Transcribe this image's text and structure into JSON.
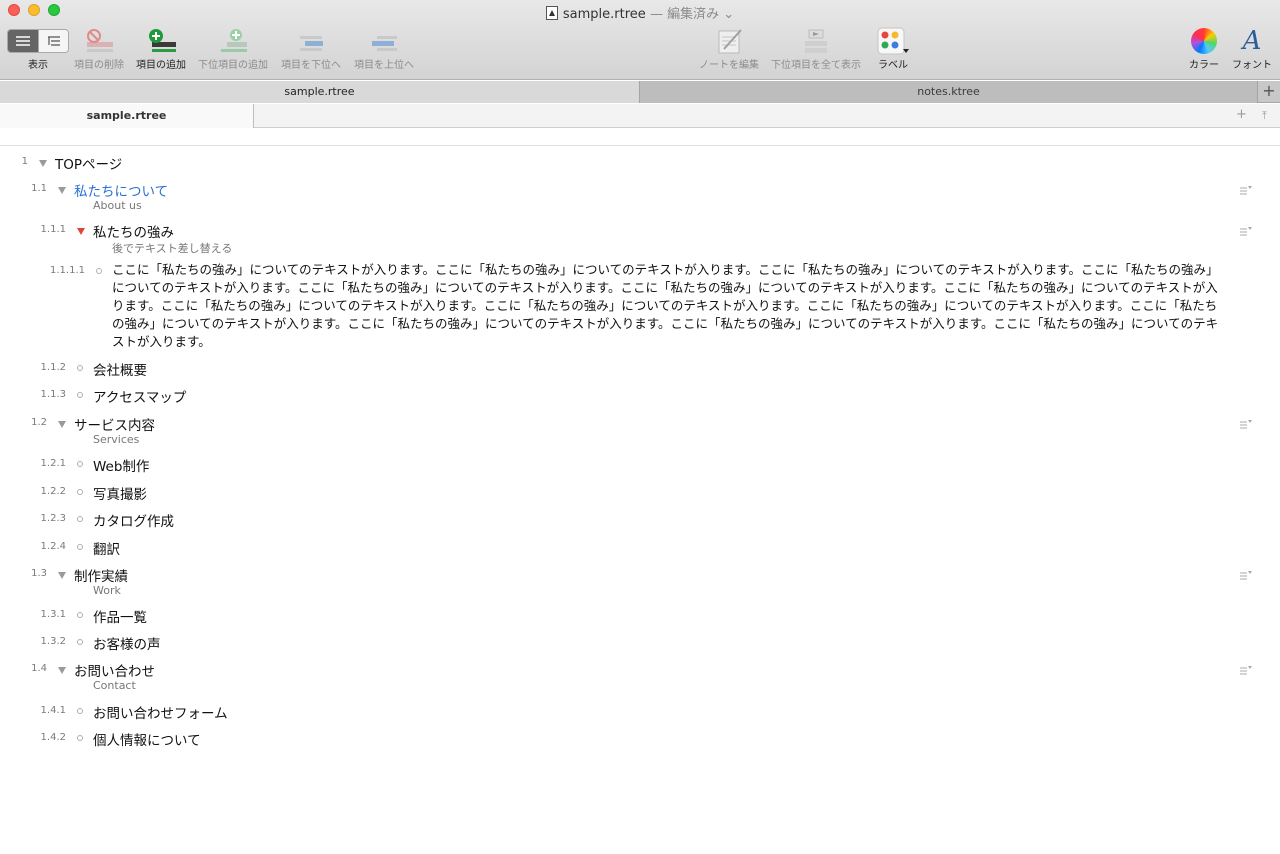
{
  "window": {
    "filename": "sample.rtree",
    "edited": "— 編集済み ⌄"
  },
  "toolbar": {
    "view": "表示",
    "delete_item": "項目の削除",
    "add_item": "項目の追加",
    "add_child": "下位項目の追加",
    "move_down": "項目を下位へ",
    "move_up": "項目を上位へ",
    "edit_note": "ノートを編集",
    "show_all": "下位項目を全て表示",
    "label": "ラベル",
    "color": "カラー",
    "font": "フォント"
  },
  "tabs": {
    "tab1": "sample.rtree",
    "tab2": "notes.ktree",
    "add": "+"
  },
  "subtabs": {
    "tab1": "sample.rtree",
    "plus": "+",
    "pin": "⤒"
  },
  "outline": {
    "r1": {
      "num": "1",
      "title": "TOPページ"
    },
    "r2": {
      "num": "1.1",
      "title": "私たちについて",
      "sub": "About us"
    },
    "r3": {
      "num": "1.1.1",
      "title": "私たちの強み",
      "sub": "後でテキスト差し替える"
    },
    "r4": {
      "num": "1.1.1.1",
      "text": "ここに「私たちの強み」についてのテキストが入ります。ここに「私たちの強み」についてのテキストが入ります。ここに「私たちの強み」についてのテキストが入ります。ここに「私たちの強み」についてのテキストが入ります。ここに「私たちの強み」についてのテキストが入ります。ここに「私たちの強み」についてのテキストが入ります。ここに「私たちの強み」についてのテキストが入ります。ここに「私たちの強み」についてのテキストが入ります。ここに「私たちの強み」についてのテキストが入ります。ここに「私たちの強み」についてのテキストが入ります。ここに「私たちの強み」についてのテキストが入ります。ここに「私たちの強み」についてのテキストが入ります。ここに「私たちの強み」についてのテキストが入ります。ここに「私たちの強み」についてのテキストが入ります。"
    },
    "r5": {
      "num": "1.1.2",
      "title": "会社概要"
    },
    "r6": {
      "num": "1.1.3",
      "title": "アクセスマップ"
    },
    "r7": {
      "num": "1.2",
      "title": "サービス内容",
      "sub": "Services"
    },
    "r8": {
      "num": "1.2.1",
      "title": "Web制作"
    },
    "r9": {
      "num": "1.2.2",
      "title": "写真撮影"
    },
    "r10": {
      "num": "1.2.3",
      "title": "カタログ作成"
    },
    "r11": {
      "num": "1.2.4",
      "title": "翻訳"
    },
    "r12": {
      "num": "1.3",
      "title": "制作実績",
      "sub": "Work"
    },
    "r13": {
      "num": "1.3.1",
      "title": "作品一覧"
    },
    "r14": {
      "num": "1.3.2",
      "title": "お客様の声"
    },
    "r15": {
      "num": "1.4",
      "title": "お問い合わせ",
      "sub": "Contact"
    },
    "r16": {
      "num": "1.4.1",
      "title": "お問い合わせフォーム"
    },
    "r17": {
      "num": "1.4.2",
      "title": "個人情報について"
    }
  },
  "colors": {
    "link": "#2a6fd6",
    "red_triangle": "#e0443a",
    "add_green": "#1f9a3a"
  }
}
